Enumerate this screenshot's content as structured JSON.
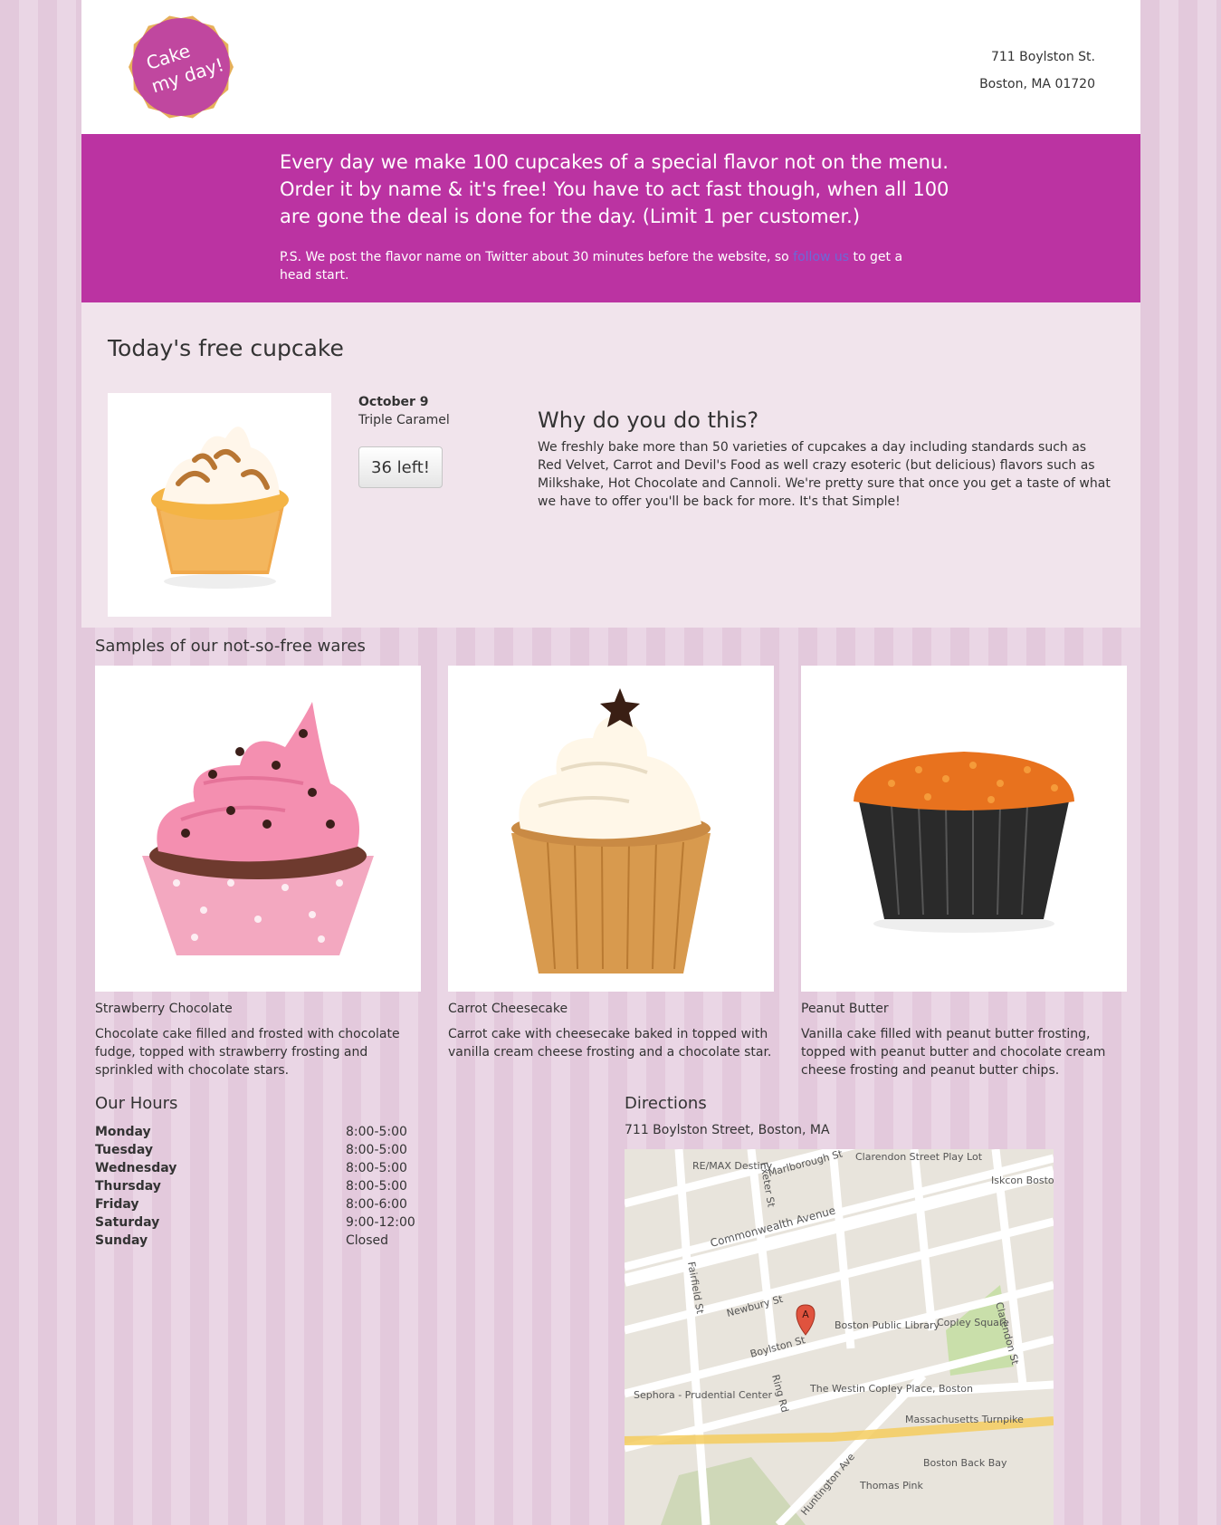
{
  "header": {
    "logo_text_line1": "Cake",
    "logo_text_line2": "my day!",
    "address_line1": "711 Boylston St.",
    "address_line2": "Boston, MA 01720"
  },
  "banner": {
    "lead": "Every day we make 100 cupcakes of a special flavor not on the menu. Order it by name & it's free! You have to act fast though, when all 100 are gone the deal is done for the day. (Limit 1 per customer.)",
    "ps_before": "P.S. We post the flavor name on Twitter about 30 minutes before the website, so ",
    "ps_link": "follow us",
    "ps_after": " to get a head start."
  },
  "today": {
    "title": "Today's free cupcake",
    "date": "October 9",
    "flavor": "Triple Caramel",
    "button_label": "36 left!",
    "why_title": "Why do you do this?",
    "why_text": "We freshly bake more than 50 varieties of cupcakes a day including standards such as Red Velvet, Carrot and Devil's Food as well crazy esoteric (but delicious) flavors such as Milkshake, Hot Chocolate and Cannoli. We're pretty sure that once you get a taste of what we have to offer you'll be back for more. It's that Simple!"
  },
  "samples": {
    "title": "Samples of our not-so-free wares",
    "items": [
      {
        "name": "Strawberry Chocolate",
        "desc": "Chocolate cake filled and frosted with chocolate fudge, topped with strawberry frosting and sprinkled with chocolate stars."
      },
      {
        "name": "Carrot Cheesecake",
        "desc": "Carrot cake with cheesecake baked in topped with vanilla cream cheese frosting and a chocolate star."
      },
      {
        "name": "Peanut Butter",
        "desc": "Vanilla cake filled with peanut butter frosting, topped with peanut butter and chocolate cream cheese frosting and peanut butter chips."
      }
    ]
  },
  "hours": {
    "title": "Our Hours",
    "rows": [
      {
        "day": "Monday",
        "time": "8:00-5:00"
      },
      {
        "day": "Tuesday",
        "time": "8:00-5:00"
      },
      {
        "day": "Wednesday",
        "time": "8:00-5:00"
      },
      {
        "day": "Thursday",
        "time": "8:00-5:00"
      },
      {
        "day": "Friday",
        "time": "8:00-6:00"
      },
      {
        "day": "Saturday",
        "time": "9:00-12:00"
      },
      {
        "day": "Sunday",
        "time": "Closed"
      }
    ]
  },
  "directions": {
    "title": "Directions",
    "address": "711 Boylston Street, Boston, MA",
    "map_labels": {
      "a1": "Marlborough St",
      "a2": "Commonwealth Avenue",
      "a3": "Newbury St",
      "a4": "Boylston St",
      "a5": "Boston Public Library",
      "a6": "Copley Square",
      "a7": "Clarendon St",
      "a8": "Exeter St",
      "a9": "Fairfield St",
      "a10": "Ring Rd",
      "a11": "Huntington Ave",
      "a12": "Massachusetts Turnpike",
      "a13": "The Westin Copley Place, Boston",
      "a14": "Sephora - Prudential Center",
      "a15": "Boston Back Bay",
      "a16": "Thomas Pink",
      "a17": "RE/MAX Destiny",
      "a18": "Iskcon Boston",
      "a19": "Clarendon Street Play Lot",
      "a20": "A"
    },
    "colors": {
      "road": "#ffffff",
      "park": "#c9dfaa",
      "block": "#e8e4dc",
      "highway": "#f5cc5e",
      "marker": "#e0533e"
    }
  },
  "colors": {
    "brand": "#bb33a2",
    "logo": "#c0479f",
    "panel": "#f1e4ec"
  }
}
